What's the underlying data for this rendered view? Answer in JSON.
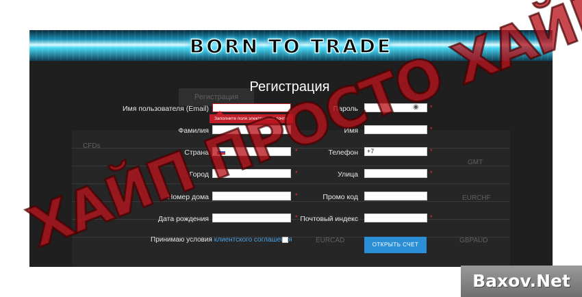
{
  "banner": {
    "title": "BORN TO TRADE"
  },
  "form": {
    "title": "Регистрация",
    "fields": {
      "username": {
        "label": "Имя пользователя (Email)",
        "value": ""
      },
      "password": {
        "label": "Пароль",
        "value": ""
      },
      "lastname": {
        "label": "Фамилия",
        "value": ""
      },
      "firstname": {
        "label": "Имя",
        "value": ""
      },
      "country": {
        "label": "Страна",
        "value": ""
      },
      "phone": {
        "label": "Телефон",
        "value": "+7"
      },
      "city": {
        "label": "Город",
        "value": ""
      },
      "street": {
        "label": "Улица",
        "value": ""
      },
      "house": {
        "label": "Номер дома",
        "value": ""
      },
      "promo": {
        "label": "Промо код",
        "value": ""
      },
      "birthdate": {
        "label": "Дата рождения",
        "value": ""
      },
      "postcode": {
        "label": "Почтовый индекс",
        "value": ""
      }
    },
    "error_tooltip": "Заполните поля электронной почты",
    "required_mark": "*",
    "terms_prefix": "Принимаю условия",
    "terms_link": "клиентского соглашения",
    "submit_label": "ОТКРЫТЬ СЧЕТ"
  },
  "background": {
    "tab": "Регистрация",
    "texts": [
      "CFDs",
      "EURCHF",
      "EURCAD",
      "GBPAUD",
      "GMT"
    ]
  },
  "overlay": {
    "watermark": "ХАЙП ПРОСТО ХАЙП",
    "brand": "Baxov.Net"
  },
  "colors": {
    "accent": "#2a8fd6",
    "error": "#c21f2b",
    "banner_glow": "#46d6f2"
  }
}
